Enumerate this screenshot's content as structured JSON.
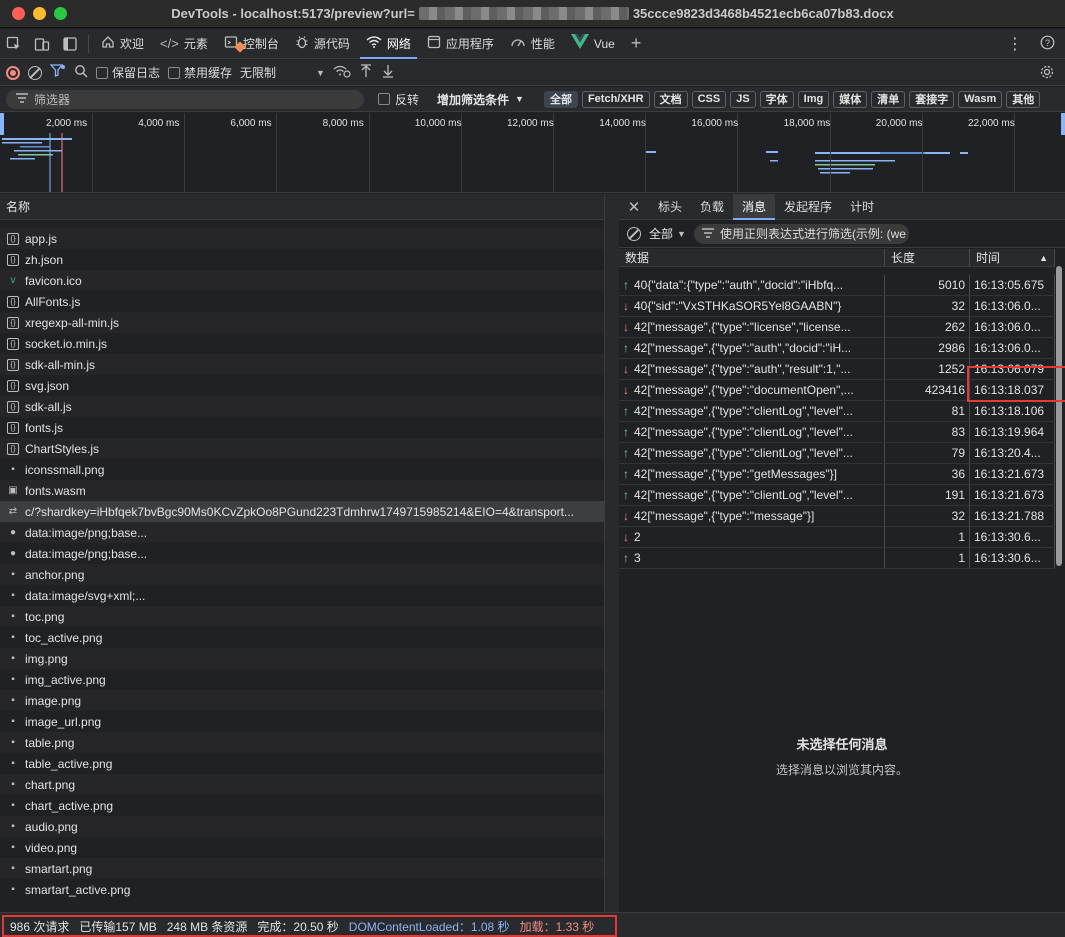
{
  "window": {
    "title_prefix": "DevTools - localhost:5173/preview?url=",
    "title_suffix": "35ccce9823d3468b4521ecb6ca07b83.docx"
  },
  "tabs": [
    {
      "label": "欢迎",
      "icon": "home-icon"
    },
    {
      "label": "元素",
      "icon": "code-icon"
    },
    {
      "label": "控制台",
      "icon": "console-icon"
    },
    {
      "label": "源代码",
      "icon": "bug-icon"
    },
    {
      "label": "网络",
      "icon": "wifi-icon"
    },
    {
      "label": "应用程序",
      "icon": "app-icon"
    },
    {
      "label": "性能",
      "icon": "gauge-icon"
    },
    {
      "label": "Vue",
      "icon": "vue-icon"
    }
  ],
  "toolbar": {
    "preserve_log": "保留日志",
    "disable_cache": "禁用缓存",
    "throttle": "无限制"
  },
  "filterbar": {
    "placeholder": "筛选器",
    "invert": "反转",
    "more_filters": "增加筛选条件",
    "chips": [
      "全部",
      "Fetch/XHR",
      "文档",
      "CSS",
      "JS",
      "字体",
      "Img",
      "媒体",
      "清单",
      "套接字",
      "Wasm",
      "其他"
    ]
  },
  "overview": {
    "ticks": [
      "2,000 ms",
      "4,000 ms",
      "6,000 ms",
      "8,000 ms",
      "10,000 ms",
      "12,000 ms",
      "14,000 ms",
      "16,000 ms",
      "18,000 ms",
      "20,000 ms",
      "22,000 ms"
    ]
  },
  "requests": {
    "header": "名称",
    "rows": [
      {
        "name": "app.js",
        "icon": "js"
      },
      {
        "name": "zh.json",
        "icon": "json"
      },
      {
        "name": "favicon.ico",
        "icon": "img"
      },
      {
        "name": "AllFonts.js",
        "icon": "js"
      },
      {
        "name": "xregexp-all-min.js",
        "icon": "js"
      },
      {
        "name": "socket.io.min.js",
        "icon": "js"
      },
      {
        "name": "sdk-all-min.js",
        "icon": "js"
      },
      {
        "name": "svg.json",
        "icon": "json"
      },
      {
        "name": "sdk-all.js",
        "icon": "js"
      },
      {
        "name": "fonts.js",
        "icon": "js"
      },
      {
        "name": "ChartStyles.js",
        "icon": "js"
      },
      {
        "name": "iconssmall.png",
        "icon": "img"
      },
      {
        "name": "fonts.wasm",
        "icon": "wasm"
      },
      {
        "name": "c/?shardkey=iHbfqek7bvBgc90Ms0KCvZpkOo8PGund223Tdmhrw1749715985214&EIO=4&transport...",
        "icon": "ws"
      },
      {
        "name": "data:image/png;base...",
        "icon": "dot"
      },
      {
        "name": "data:image/png;base...",
        "icon": "dot"
      },
      {
        "name": "anchor.png",
        "icon": "img"
      },
      {
        "name": "data:image/svg+xml;...",
        "icon": "img"
      },
      {
        "name": "toc.png",
        "icon": "img"
      },
      {
        "name": "toc_active.png",
        "icon": "img"
      },
      {
        "name": "img.png",
        "icon": "img"
      },
      {
        "name": "img_active.png",
        "icon": "img"
      },
      {
        "name": "image.png",
        "icon": "img"
      },
      {
        "name": "image_url.png",
        "icon": "img"
      },
      {
        "name": "table.png",
        "icon": "img"
      },
      {
        "name": "table_active.png",
        "icon": "img"
      },
      {
        "name": "chart.png",
        "icon": "img"
      },
      {
        "name": "chart_active.png",
        "icon": "img"
      },
      {
        "name": "audio.png",
        "icon": "img"
      },
      {
        "name": "video.png",
        "icon": "img"
      },
      {
        "name": "smartart.png",
        "icon": "img"
      },
      {
        "name": "smartart_active.png",
        "icon": "img"
      }
    ]
  },
  "detail": {
    "tabs": [
      "标头",
      "负载",
      "消息",
      "发起程序",
      "计时"
    ],
    "active_tab": "消息",
    "msg_select": "全部",
    "msg_filter_placeholder": "使用正则表达式进行筛选(示例: (we",
    "columns": [
      "数据",
      "长度",
      "时间"
    ],
    "messages": [
      {
        "dir": "up",
        "data": "40{\"data\":{\"type\":\"auth\",\"docid\":\"iHbfq...",
        "len": "5010",
        "time": "16:13:05.675"
      },
      {
        "dir": "down",
        "data": "40{\"sid\":\"VxSTHKaSOR5Yel8GAABN\"}",
        "len": "32",
        "time": "16:13:06.0..."
      },
      {
        "dir": "down",
        "data": "42[\"message\",{\"type\":\"license\",\"license...",
        "len": "262",
        "time": "16:13:06.0..."
      },
      {
        "dir": "up",
        "data": "42[\"message\",{\"type\":\"auth\",\"docid\":\"iH...",
        "len": "2986",
        "time": "16:13:06.0..."
      },
      {
        "dir": "down",
        "data": "42[\"message\",{\"type\":\"auth\",\"result\":1,\"...",
        "len": "1252",
        "time": "16:13:06.079"
      },
      {
        "dir": "down",
        "data": "42[\"message\",{\"type\":\"documentOpen\",...",
        "len": "423416",
        "time": "16:13:18.037"
      },
      {
        "dir": "up",
        "data": "42[\"message\",{\"type\":\"clientLog\",\"level\"...",
        "len": "81",
        "time": "16:13:18.106"
      },
      {
        "dir": "up",
        "data": "42[\"message\",{\"type\":\"clientLog\",\"level\"...",
        "len": "83",
        "time": "16:13:19.964"
      },
      {
        "dir": "up",
        "data": "42[\"message\",{\"type\":\"clientLog\",\"level\"...",
        "len": "79",
        "time": "16:13:20.4..."
      },
      {
        "dir": "up",
        "data": "42[\"message\",{\"type\":\"getMessages\"}]",
        "len": "36",
        "time": "16:13:21.673"
      },
      {
        "dir": "up",
        "data": "42[\"message\",{\"type\":\"clientLog\",\"level\"...",
        "len": "191",
        "time": "16:13:21.673"
      },
      {
        "dir": "down",
        "data": "42[\"message\",{\"type\":\"message\"}]",
        "len": "32",
        "time": "16:13:21.788"
      },
      {
        "dir": "down",
        "data": "2",
        "len": "1",
        "time": "16:13:30.6..."
      },
      {
        "dir": "up",
        "data": "3",
        "len": "1",
        "time": "16:13:30.6..."
      }
    ],
    "empty_title": "未选择任何消息",
    "empty_sub": "选择消息以浏览其内容。"
  },
  "status": {
    "requests": "986 次请求",
    "transferred": "已传输157 MB",
    "resources": "248 MB 条资源",
    "finish": "完成：20.50 秒",
    "dcl": "DOMContentLoaded：1.08 秒",
    "load": "加载：1.33 秒"
  }
}
